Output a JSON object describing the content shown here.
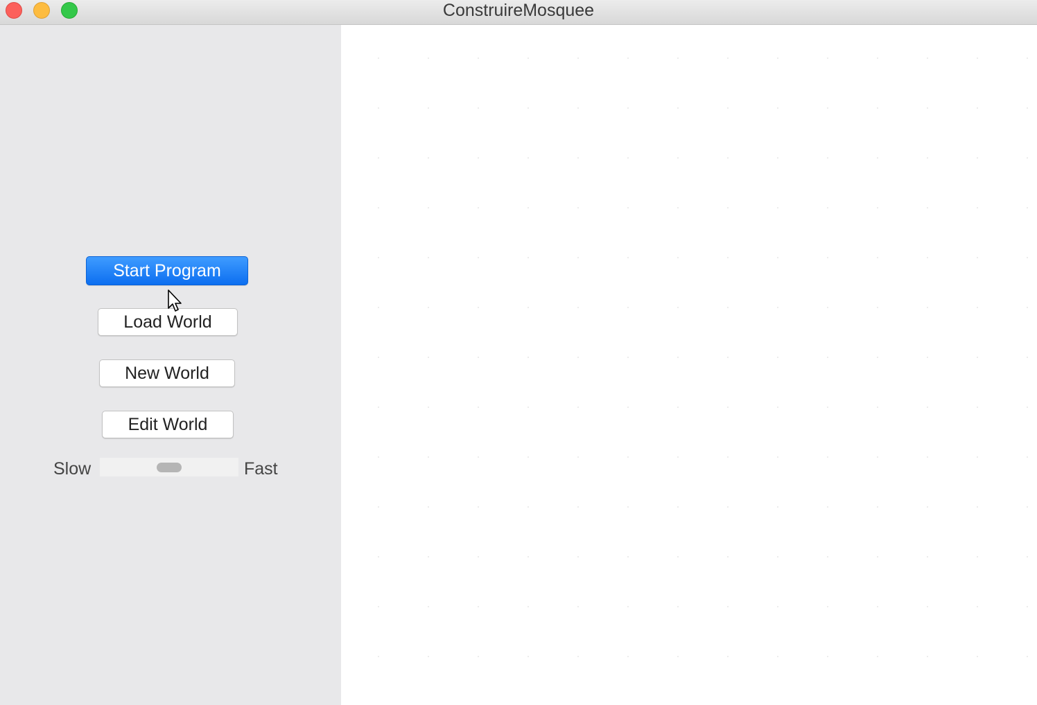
{
  "window": {
    "title": "ConstruireMosquee"
  },
  "sidebar": {
    "buttons": {
      "start": "Start Program",
      "load": "Load World",
      "new": "New World",
      "edit": "Edit World"
    },
    "speed": {
      "slow_label": "Slow",
      "fast_label": "Fast",
      "value_fraction": 0.5
    }
  },
  "colors": {
    "primary_button": "#0c6ef0",
    "sidebar_bg": "#e8e8ea",
    "canvas_bg": "#ffffff"
  },
  "icons": {
    "close": "close-icon",
    "minimize": "minimize-icon",
    "maximize": "maximize-icon",
    "cursor": "mouse-pointer-icon"
  }
}
